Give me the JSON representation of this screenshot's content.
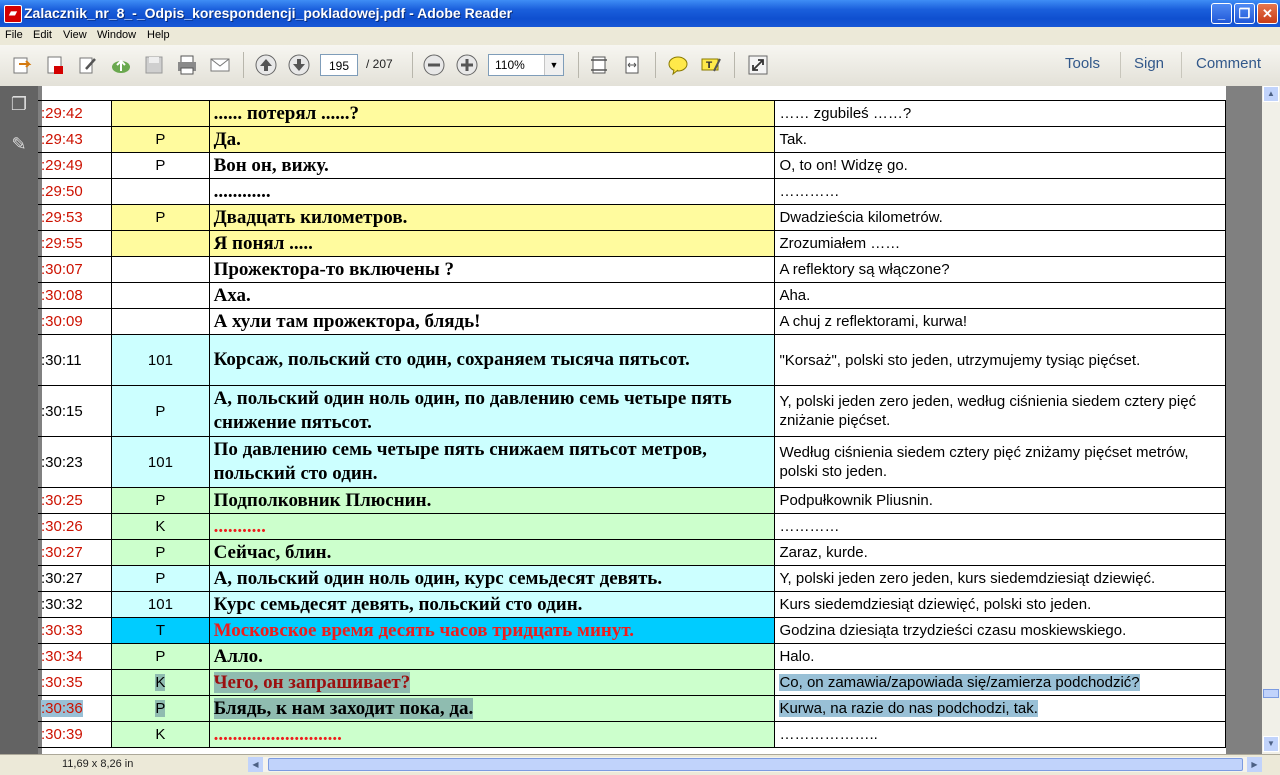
{
  "window": {
    "title": "Zalacznik_nr_8_-_Odpis_korespondencji_pokladowej.pdf - Adobe Reader",
    "app_icon": "pdf-icon",
    "controls": [
      "minimize-icon",
      "maximize-icon",
      "close-icon"
    ]
  },
  "menu": [
    "File",
    "Edit",
    "View",
    "Window",
    "Help"
  ],
  "toolbar": {
    "page_current": "195",
    "page_total": "/ 207",
    "zoom": "110%",
    "tools_label": "Tools",
    "sign_label": "Sign",
    "comment_label": "Comment"
  },
  "status": {
    "page_size": "11,69 x 8,26 in"
  },
  "transcript": {
    "rows": [
      {
        "time": ":29:42",
        "speaker": "",
        "ru": "...... потерял ......?",
        "pl": "…… zgubileś ……?",
        "bg": "yellow"
      },
      {
        "time": ":29:43",
        "speaker": "P",
        "ru": "Да.",
        "pl": "Tak.",
        "bg": "yellow"
      },
      {
        "time": ":29:49",
        "speaker": "P",
        "ru": "Вон он, вижу.",
        "pl": "O, to on! Widzę go.",
        "bg": "white"
      },
      {
        "time": ":29:50",
        "speaker": "",
        "ru": "............",
        "pl": "…………",
        "bg": "white"
      },
      {
        "time": ":29:53",
        "speaker": "P",
        "ru": "Двадцать километров.",
        "pl": "Dwadzieścia kilometrów.",
        "bg": "yellow"
      },
      {
        "time": ":29:55",
        "speaker": "",
        "ru": "Я понял .....",
        "pl": "Zrozumiałem ……",
        "bg": "yellow"
      },
      {
        "time": ":30:07",
        "speaker": "",
        "ru": "Прожектора-то включены ?",
        "pl": "A reflektory są włączone?",
        "bg": "white"
      },
      {
        "time": ":30:08",
        "speaker": "",
        "ru": "Аха.",
        "pl": "Aha.",
        "bg": "white"
      },
      {
        "time": ":30:09",
        "speaker": "",
        "ru": "А хули там прожектора, блядь!",
        "pl": "A chuj z reflektorami, kurwa!",
        "bg": "white"
      },
      {
        "time": ":30:11",
        "speaker": "101",
        "ru": "Корсаж, польский сто один, сохраняем тысяча пятьсот.",
        "pl": "\"Korsaż\", polski sto jeden, utrzymujemy tysiąc pięćset.",
        "bg": "cyan",
        "tall": true,
        "time_black": true
      },
      {
        "time": ":30:15",
        "speaker": "P",
        "ru": "А, польский один ноль один, по давлению семь четыре пять снижение пятьсот.",
        "pl": "Y, polski jeden zero jeden, według ciśnienia siedem cztery pięć zniżanie pięćset.",
        "bg": "cyan",
        "tall": true,
        "time_black": true
      },
      {
        "time": ":30:23",
        "speaker": "101",
        "ru": "По давлению семь четыре пять снижаем пятьсот метров, польский сто один.",
        "pl": "Według ciśnienia siedem cztery pięć zniżamy pięćset metrów, polski sto jeden.",
        "bg": "cyan",
        "tall": true,
        "time_black": true
      },
      {
        "time": ":30:25",
        "speaker": "P",
        "ru": "Подполковник Плюснин.",
        "pl": "Podpułkownik Pliusnin.",
        "bg": "green"
      },
      {
        "time": ":30:26",
        "speaker": "K",
        "ru": "...........",
        "pl": "…………",
        "bg": "green",
        "ru_red": true
      },
      {
        "time": ":30:27",
        "speaker": "P",
        "ru": "Сейчас, блин.",
        "pl": "Zaraz, kurde.",
        "bg": "green"
      },
      {
        "time": ":30:27",
        "speaker": "P",
        "ru": "А, польский один ноль один, курс семьдесят девять.",
        "pl": "Y, polski jeden zero jeden, kurs siedemdziesiąt dziewięć.",
        "bg": "cyan",
        "time_black": true
      },
      {
        "time": ":30:32",
        "speaker": "101",
        "ru": "Курс семьдесят девять, польский сто один.",
        "pl": "Kurs siedemdziesiąt dziewięć, polski sto jeden.",
        "bg": "cyan",
        "time_black": true
      },
      {
        "time": ":30:33",
        "speaker": "T",
        "ru": "Московское время десять часов тридцать минут.",
        "pl": "Godzina dziesiąta trzydzieści czasu moskiewskiego.",
        "bg": "blue",
        "ru_red": true
      },
      {
        "time": ":30:34",
        "speaker": "P",
        "ru": "Алло.",
        "pl": "Halo.",
        "bg": "green"
      },
      {
        "time": ":30:35",
        "speaker": "K",
        "ru": "Чего, он запрашивает?",
        "pl": "Co, on zamawia/zapowiada się/zamierza podchodzić?",
        "bg": "green",
        "ru_dred": true,
        "highlight": true
      },
      {
        "time": ":30:36",
        "speaker": "P",
        "ru": "Блядь, к нам заходит пока, да.",
        "pl": "Kurwa, na razie do nas podchodzi, tak.",
        "bg": "green",
        "highlight": true,
        "time_hl": true
      },
      {
        "time": ":30:39",
        "speaker": "K",
        "ru": "...........................",
        "pl": "………………..",
        "bg": "green",
        "ru_red": true
      }
    ]
  }
}
